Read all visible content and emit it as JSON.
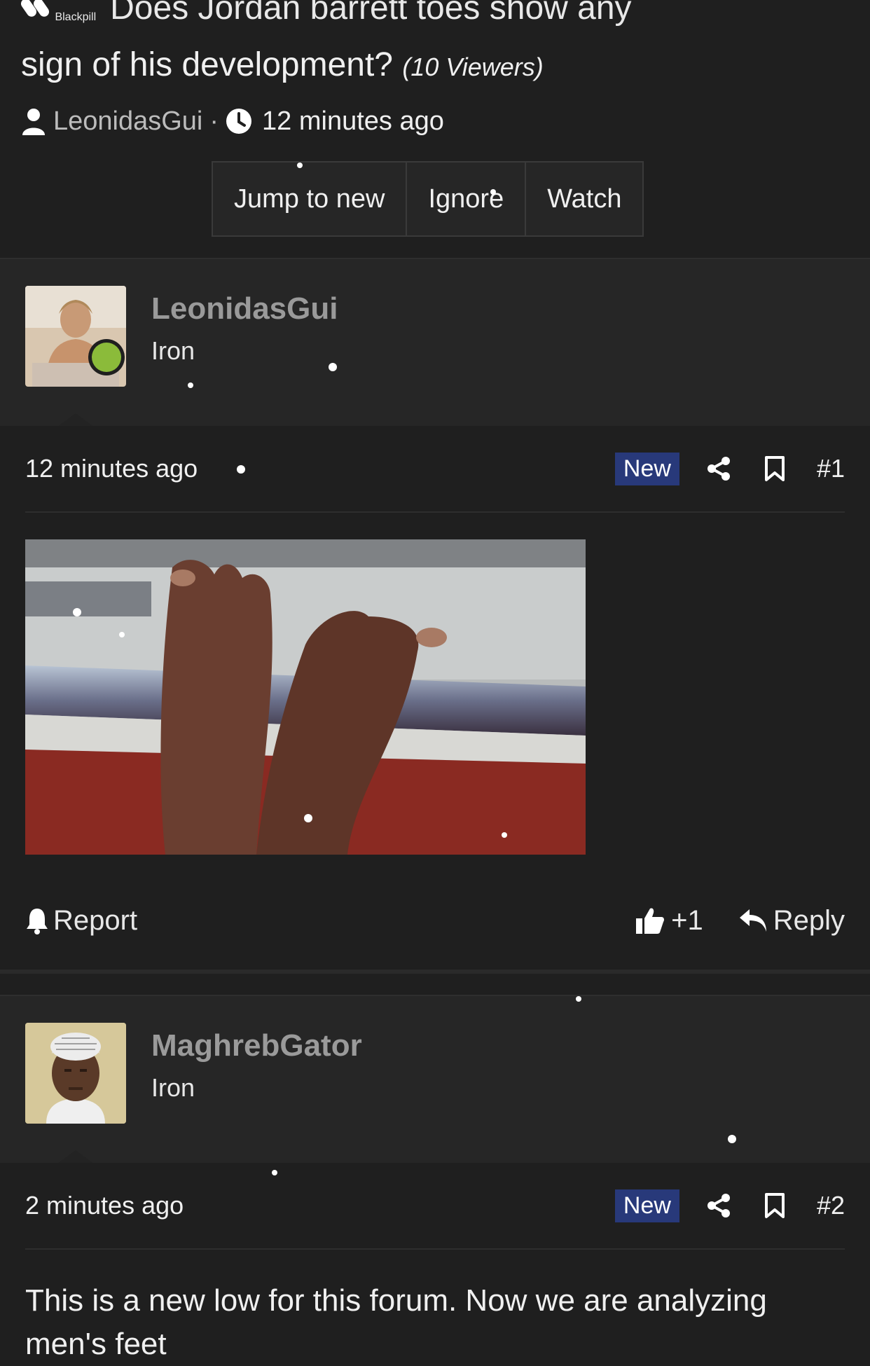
{
  "thread": {
    "prefix": "Blackpill",
    "title_line1": "Does Jordan barrett toes show any",
    "title_line2": "sign of his development?",
    "viewers": "(10 Viewers)",
    "author": "LeonidasGui",
    "separator": "·",
    "time": "12 minutes ago",
    "buttons": [
      "Jump to new",
      "Ignore",
      "Watch"
    ]
  },
  "posts": [
    {
      "username": "LeonidasGui",
      "user_title": "Iron",
      "date": "12 minutes ago",
      "badge": "New",
      "number": "#1",
      "report_label": "Report",
      "reaction": "+1",
      "reply_label": "Reply",
      "online": true
    },
    {
      "username": "MaghrebGator",
      "user_title": "Iron",
      "date": "2 minutes ago",
      "badge": "New",
      "number": "#2",
      "text": "This is a new low for this forum. Now we are analyzing men's feet"
    }
  ],
  "icons": {
    "prefix_icon": "blackpill-icon",
    "user_icon": "user-icon",
    "clock_icon": "clock-icon",
    "share_icon": "share-icon",
    "bookmark_icon": "bookmark-icon",
    "bell_icon": "bell-icon",
    "thumbs_up_icon": "thumbs-up-icon",
    "reply_icon": "reply-icon"
  },
  "colors": {
    "background": "#1f1f1f",
    "new_badge": "#28397a",
    "online": "#8bbb3a"
  }
}
